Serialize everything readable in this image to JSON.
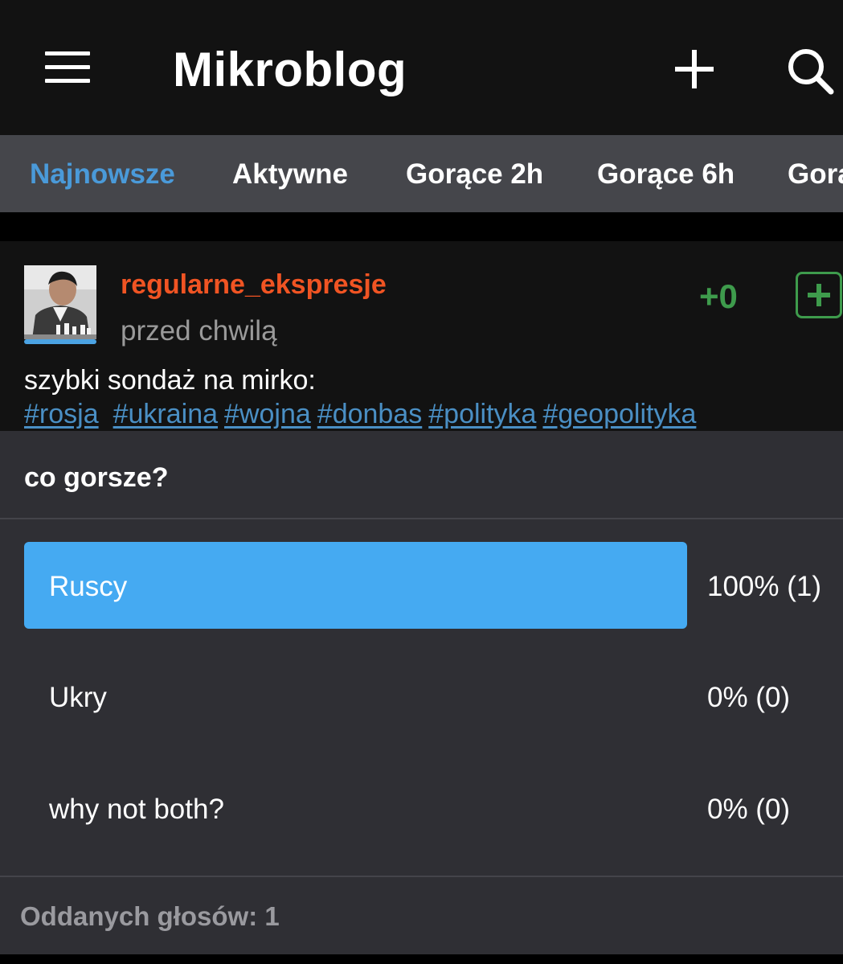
{
  "header": {
    "title": "Mikroblog",
    "menu_icon": "hamburger-menu-icon",
    "add_icon": "plus-icon",
    "search_icon": "search-icon"
  },
  "tabs": [
    {
      "label": "Najnowsze",
      "active": true
    },
    {
      "label": "Aktywne",
      "active": false
    },
    {
      "label": "Gorące 2h",
      "active": false
    },
    {
      "label": "Gorące 6h",
      "active": false
    },
    {
      "label": "Gora",
      "active": false
    }
  ],
  "entry": {
    "username": "regularne_ekspresje",
    "time": "przed chwilą",
    "score": "+0",
    "text": "szybki sondaż na mirko:",
    "tags": [
      "#rosja",
      "#ukraina",
      "#wojna",
      "#donbas",
      "#polityka",
      "#geopolityka"
    ]
  },
  "poll": {
    "question": "co gorsze?",
    "options": [
      {
        "label": "Ruscy",
        "result": "100% (1)",
        "share": 1.0
      },
      {
        "label": "Ukry",
        "result": "0% (0)",
        "share": 0
      },
      {
        "label": "why not both?",
        "result": "0% (0)",
        "share": 0
      }
    ],
    "footer": "Oddanych głosów: 1"
  },
  "colors": {
    "accent_blue": "#45aaf2",
    "tab_active": "#4a9ad9",
    "username_orange": "#f05423",
    "vote_green": "#3e9b4c",
    "tag_blue": "#4a8fc4"
  }
}
